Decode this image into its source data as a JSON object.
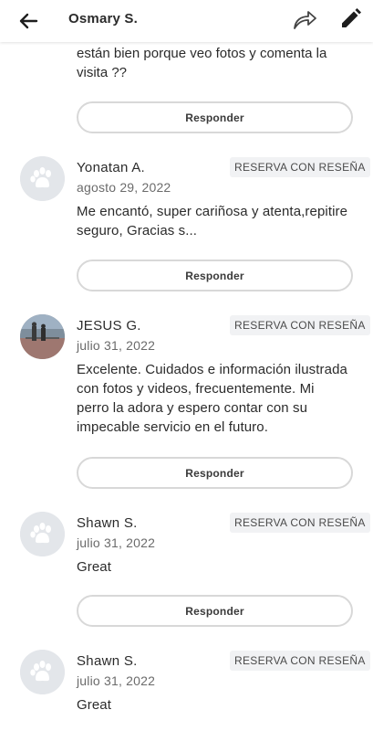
{
  "header": {
    "title": "Osmary S.",
    "back_icon": "arrow-left-icon",
    "share_icon": "share-arrow-icon",
    "edit_icon": "pencil-icon"
  },
  "previous_review": {
    "text_tail": "están bien porque veo fotos y comenta la visita ??",
    "reply_label": "Responder"
  },
  "reviews": [
    {
      "name": "Yonatan A.",
      "tag": "RESERVA CON RESEÑA",
      "date": "agosto 29, 2022",
      "text": "Me encantó, super cariñosa y atenta,repitire seguro, Gracias s...",
      "avatar": "paw-placeholder",
      "reply_label": "Responder"
    },
    {
      "name": "JESUS G.",
      "tag": "RESERVA CON RESEÑA",
      "date": "julio 31, 2022",
      "text": "Excelente. Cuidados e información ilustrada con fotos y videos, frecuentemente. Mi perro la adora y espero contar con su impecable servicio en el futuro.",
      "avatar": "photo",
      "reply_label": "Responder"
    },
    {
      "name": "Shawn S.",
      "tag": "RESERVA CON RESEÑA",
      "date": "julio 31, 2022",
      "text": "Great",
      "avatar": "paw-placeholder",
      "reply_label": "Responder"
    },
    {
      "name": "Shawn S.",
      "tag": "RESERVA CON RESEÑA",
      "date": "julio 31, 2022",
      "text": "Great",
      "avatar": "paw-placeholder"
    }
  ],
  "colors": {
    "text": "#2b2b2b",
    "muted": "#6b6b6b",
    "tag_bg": "#f1f2f4",
    "button_border": "#d8d8d8",
    "avatar_bg": "#e3e6ea"
  }
}
